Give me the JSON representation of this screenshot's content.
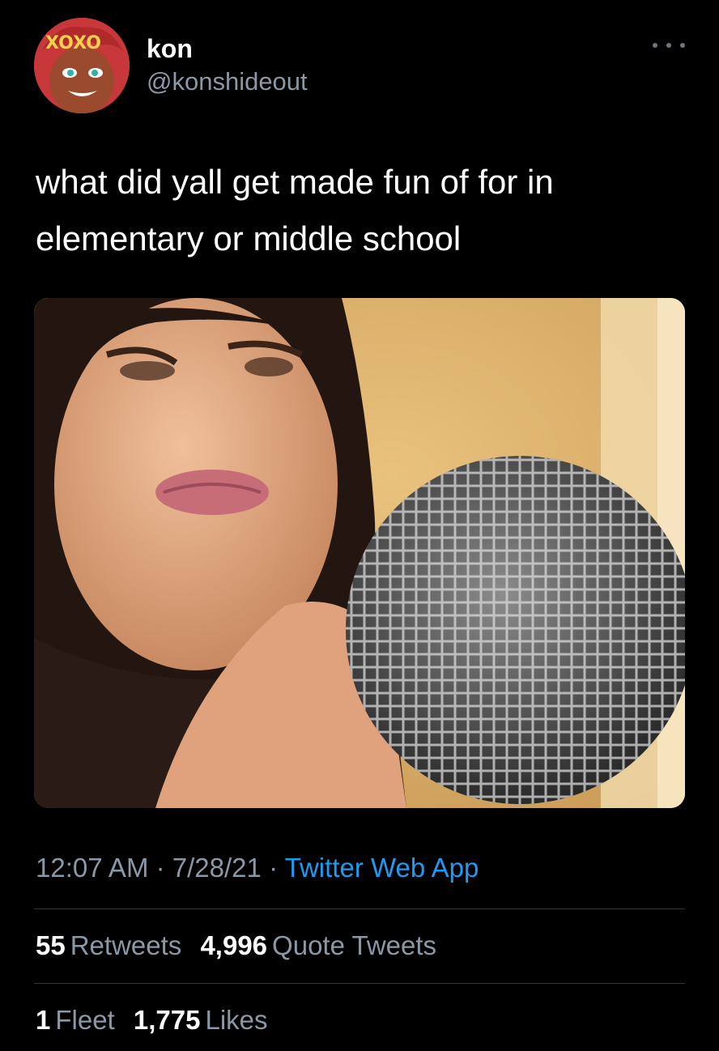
{
  "tweet": {
    "author": {
      "display_name": "kon",
      "handle": "@konshideout",
      "avatar_text": "XOXO"
    },
    "text": "what did yall get made fun of for in elementary or middle school",
    "media": {
      "type": "photo",
      "alt": ""
    },
    "time": "12:07 AM",
    "date": "7/28/21",
    "separator": "·",
    "source": "Twitter Web App",
    "stats": {
      "retweets": {
        "count": "55",
        "label": "Retweets"
      },
      "quote_tweets": {
        "count": "4,996",
        "label": "Quote Tweets"
      },
      "fleets": {
        "count": "1",
        "label": "Fleet"
      },
      "likes": {
        "count": "1,775",
        "label": "Likes"
      }
    }
  },
  "icons": {
    "more": "more-horizontal-icon"
  },
  "colors": {
    "background": "#000000",
    "primary_text": "#ffffff",
    "secondary_text": "#8b98a5",
    "link": "#1d9bf0",
    "divider": "#2f3336"
  }
}
